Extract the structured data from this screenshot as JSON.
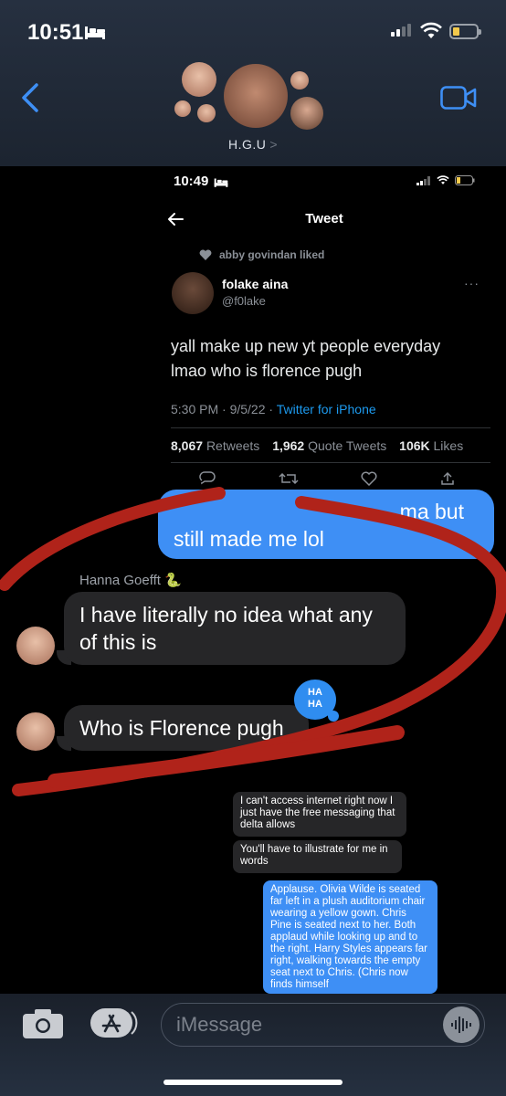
{
  "status": {
    "time": "10:51"
  },
  "header": {
    "group_name": "H.G.U",
    "chevron": ">"
  },
  "embedded": {
    "status_time": "10:49",
    "title": "Tweet",
    "liked_by": "abby govindan liked",
    "author_name": "folake aina",
    "author_handle": "@f0lake",
    "tweet_text_line1": "yall make up new yt people everyday",
    "tweet_text_line2": "lmao who is florence pugh",
    "meta_time": "5:30 PM · 9/5/22 · ",
    "meta_source": "Twitter for iPhone",
    "retweets": "8,067",
    "retweets_label": "Retweets",
    "quotes": "1,962",
    "quotes_label": "Quote Tweets",
    "likes": "106K",
    "likes_label": "Likes"
  },
  "messages": {
    "outgoing_partial": "ma but",
    "outgoing_line2": "still made me lol",
    "sender": "Hanna Goefft 🐍",
    "incoming1": "I have literally no idea what any of this is",
    "incoming2": "Who is Florence pugh",
    "reaction_line1": "HA",
    "reaction_line2": "HA"
  },
  "embedded_chat": {
    "msg1": "I can't access internet right now I just have the free messaging that delta allows",
    "msg2": "You'll have to illustrate for me in words",
    "msg3": "Applause. Olivia Wilde is seated far left in a plush auditorium chair wearing a yellow gown. Chris Pine is seated next to her. Both applaud while looking up and to the right. Harry Styles appears far right, walking towards the empty seat next to Chris. (Chris now finds himself"
  },
  "input": {
    "placeholder": "iMessage"
  },
  "colors": {
    "imessage_blue": "#3e8ff5",
    "annotation_red": "#b0231a",
    "twitter_blue": "#1d9bf0"
  }
}
